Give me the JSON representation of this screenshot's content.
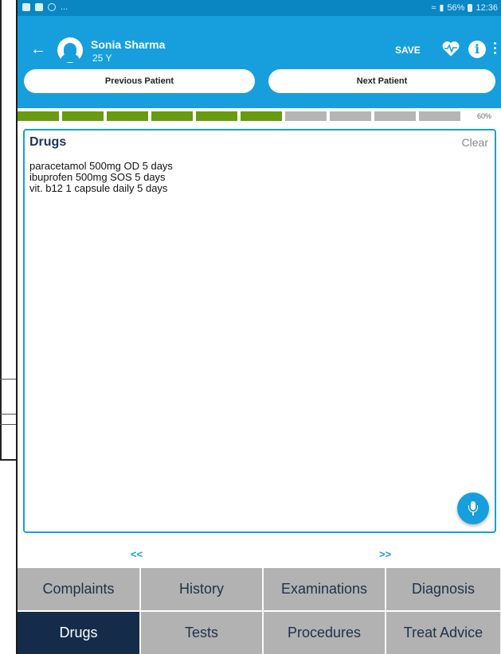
{
  "status_bar": {
    "right_text": "56%",
    "time": "12:36",
    "left_more": "..."
  },
  "header": {
    "patient_name": "Sonia Sharma",
    "patient_age": "25 Y",
    "save_label": "SAVE",
    "info_label": "i",
    "prev_patient_label": "Previous Patient",
    "next_patient_label": "Next Patient",
    "accent_color": "#169fdc"
  },
  "progress": {
    "label": "60%",
    "value": 0.6,
    "segments_total": 10,
    "segments_filled": 6,
    "filled_color": "#669c0e",
    "empty_color": "#b5b5b5"
  },
  "drugs_panel": {
    "title": "Drugs",
    "clear_label": "Clear",
    "lines": [
      "paracetamol 500mg OD 5 days",
      "ibuprofen 500mg SOS 5 days",
      "vit. b12 1 capsule daily 5 days"
    ]
  },
  "pager": {
    "prev_label": "<<",
    "next_label": ">>"
  },
  "tabs": [
    {
      "label": "Complaints",
      "active": false
    },
    {
      "label": "History",
      "active": false
    },
    {
      "label": "Examinations",
      "active": false
    },
    {
      "label": "Diagnosis",
      "active": false
    },
    {
      "label": "Drugs",
      "active": true
    },
    {
      "label": "Tests",
      "active": false
    },
    {
      "label": "Procedures",
      "active": false
    },
    {
      "label": "Treat Advice",
      "active": false
    }
  ],
  "colors": {
    "tab_active_bg": "#142b4a",
    "tab_bg": "#b2b2b2"
  }
}
